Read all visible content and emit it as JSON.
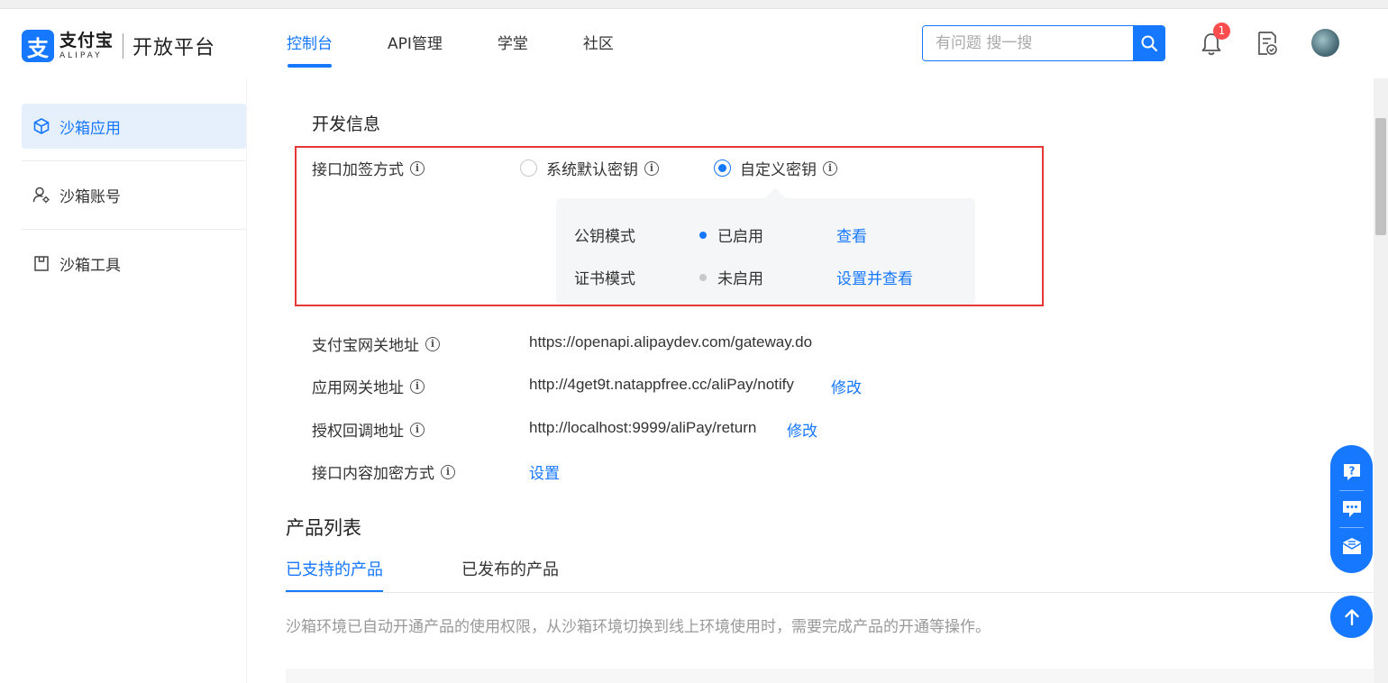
{
  "brand": {
    "logo_glyph": "支",
    "name_cn": "支付宝",
    "name_en": "ALIPAY",
    "platform": "开放平台"
  },
  "nav": {
    "items": [
      {
        "label": "控制台",
        "active": true
      },
      {
        "label": "API管理",
        "active": false
      },
      {
        "label": "学堂",
        "active": false
      },
      {
        "label": "社区",
        "active": false
      }
    ]
  },
  "search": {
    "placeholder": "有问题 搜一搜"
  },
  "notifications": {
    "count": "1"
  },
  "sidebar": {
    "items": [
      {
        "label": "沙箱应用",
        "icon": "cube-icon",
        "active": true
      },
      {
        "label": "沙箱账号",
        "icon": "user-gear-icon",
        "active": false
      },
      {
        "label": "沙箱工具",
        "icon": "tool-box-icon",
        "active": false
      }
    ]
  },
  "dev_info": {
    "title": "开发信息",
    "sign_method": {
      "label": "接口加签方式",
      "option_default": "系统默认密钥",
      "option_custom": "自定义密钥",
      "selected": "自定义密钥",
      "modes": [
        {
          "name": "公钥模式",
          "status": "已启用",
          "enabled": true,
          "action": "查看"
        },
        {
          "name": "证书模式",
          "status": "未启用",
          "enabled": false,
          "action": "设置并查看"
        }
      ]
    },
    "gateway": {
      "label": "支付宝网关地址",
      "value": "https://openapi.alipaydev.com/gateway.do"
    },
    "app_gateway": {
      "label": "应用网关地址",
      "value": "http://4get9t.natappfree.cc/aliPay/notify",
      "action": "修改"
    },
    "callback": {
      "label": "授权回调地址",
      "value": "http://localhost:9999/aliPay/return",
      "action": "修改"
    },
    "encrypt": {
      "label": "接口内容加密方式",
      "action": "设置"
    }
  },
  "products": {
    "title": "产品列表",
    "tabs": [
      {
        "label": "已支持的产品",
        "active": true
      },
      {
        "label": "已发布的产品",
        "active": false
      }
    ],
    "description": "沙箱环境已自动开通产品的使用权限，从沙箱环境切换到线上环境使用时，需要完成产品的开通等操作。"
  },
  "colors": {
    "accent": "#1677ff",
    "highlight_border": "#e53935",
    "enabled_dot": "#1677ff",
    "disabled_dot": "#c8c8c8"
  }
}
